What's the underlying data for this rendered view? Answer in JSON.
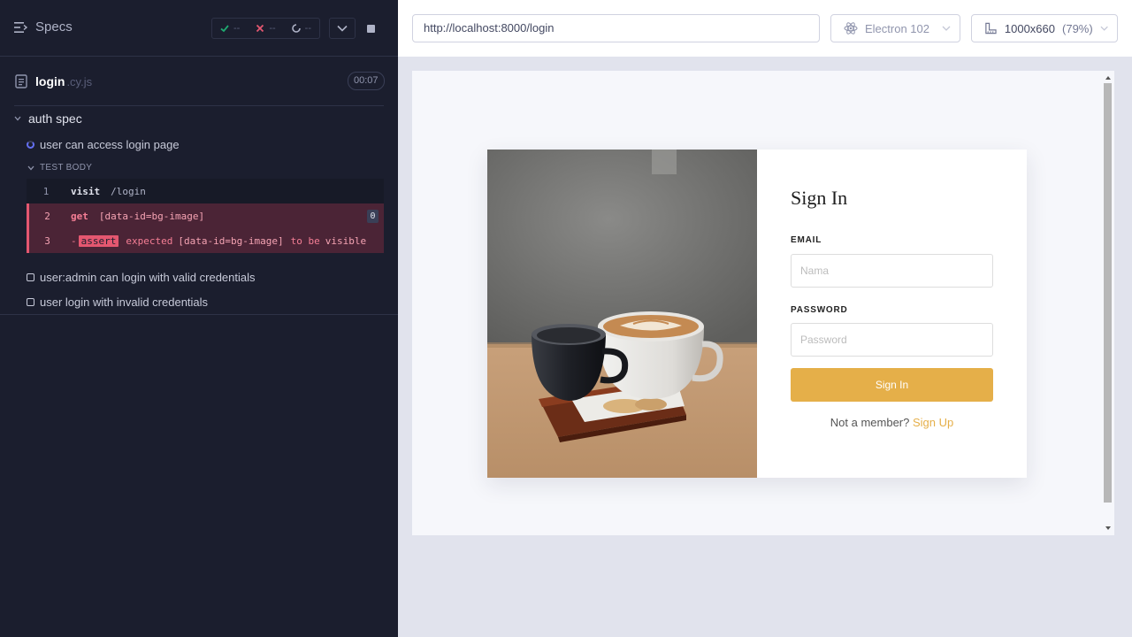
{
  "reporter": {
    "specs_label": "Specs",
    "stats": {
      "passed": "--",
      "failed": "--",
      "pending": "--"
    },
    "spec_file": {
      "name": "login",
      "ext": ".cy.js",
      "duration": "00:07"
    },
    "suite_title": "auth spec",
    "tests": [
      {
        "title": "user can access login page",
        "state": "running"
      },
      {
        "title": "user:admin can login with valid credentials",
        "state": "pending"
      },
      {
        "title": "user login with invalid credentials",
        "state": "pending"
      }
    ],
    "test_body_label": "TEST BODY",
    "commands": [
      {
        "num": "1",
        "name": "visit",
        "message": "/login"
      },
      {
        "num": "2",
        "name": "get",
        "message": "[data-id=bg-image]",
        "badge": "0"
      },
      {
        "num": "3",
        "prefix": "-",
        "name": "assert",
        "kw1": "expected",
        "selector": "[data-id=bg-image]",
        "kw2": "to be",
        "value": "visible"
      }
    ]
  },
  "aut": {
    "url": "http://localhost:8000/login",
    "browser": "Electron 102",
    "viewport": "1000x660",
    "zoom": "(79%)",
    "login_form": {
      "title": "Sign In",
      "email_label": "EMAIL",
      "email_placeholder": "Nama",
      "password_label": "PASSWORD",
      "password_placeholder": "Password",
      "submit_label": "Sign In",
      "signup_prompt": "Not a member?",
      "signup_link": "Sign Up"
    }
  },
  "colors": {
    "reporter_bg": "#1b1e2e",
    "fail_bg": "#4b2436",
    "fail_accent": "#e45770",
    "running_accent": "#6470f3",
    "brand_gold": "#e5af49"
  }
}
